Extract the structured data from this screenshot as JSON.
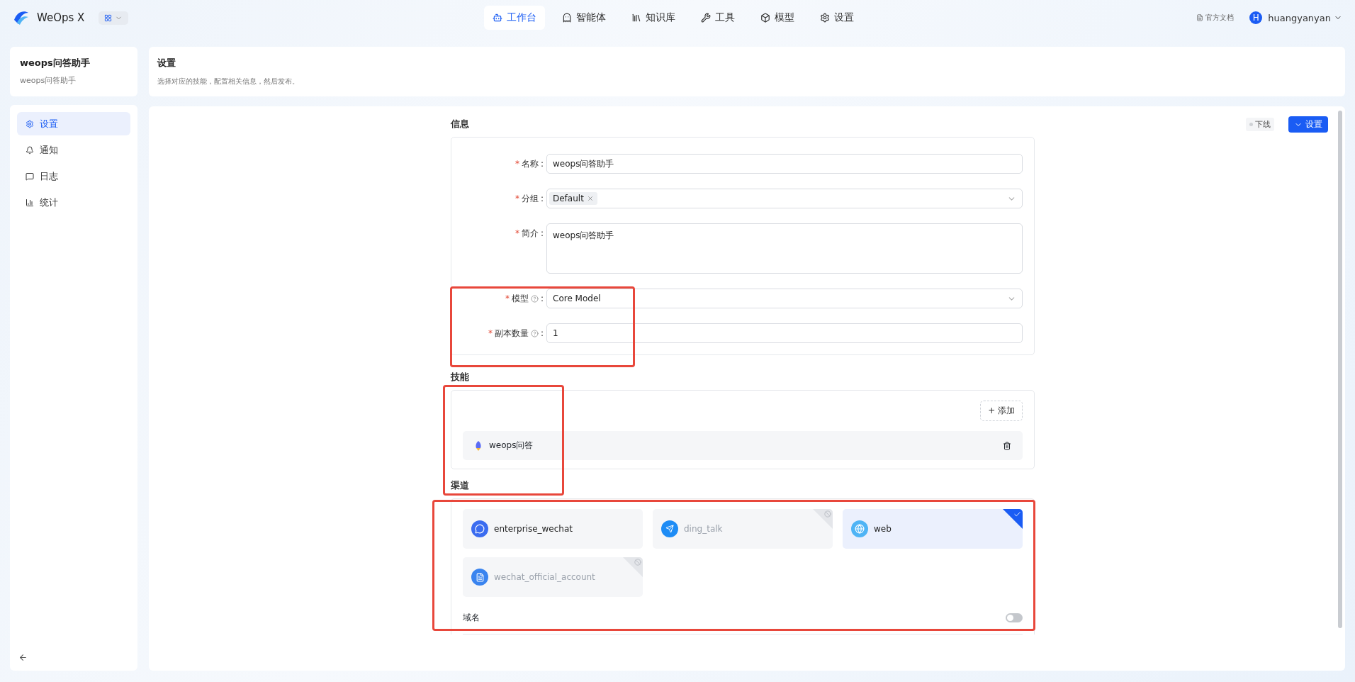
{
  "topbar": {
    "brand": "WeOps X",
    "nav": [
      {
        "label": "工作台",
        "selected": true
      },
      {
        "label": "智能体",
        "selected": false
      },
      {
        "label": "知识库",
        "selected": false
      },
      {
        "label": "工具",
        "selected": false
      },
      {
        "label": "模型",
        "selected": false
      },
      {
        "label": "设置",
        "selected": false
      }
    ],
    "docs": "官方文档",
    "avatar": "H",
    "user": "huangyanyan"
  },
  "agent": {
    "title": "weops问答助手",
    "subtitle": "weops问答助手"
  },
  "sidebar": {
    "items": [
      {
        "label": "设置",
        "selected": true
      },
      {
        "label": "通知",
        "selected": false
      },
      {
        "label": "日志",
        "selected": false
      },
      {
        "label": "统计",
        "selected": false
      }
    ]
  },
  "header": {
    "title": "设置",
    "description": "选择对应的技能，配置相关信息，然后发布。"
  },
  "actions": {
    "status": "下线",
    "button": "设置"
  },
  "info": {
    "title": "信息",
    "fields": [
      {
        "kind": "input",
        "mark": "*",
        "label": "名称",
        "help": false,
        "colon": ":",
        "value": "weops问答助手"
      },
      {
        "kind": "tags",
        "mark": "*",
        "label": "分组",
        "help": false,
        "colon": ":",
        "tags": [
          "Default"
        ]
      },
      {
        "kind": "textarea",
        "mark": "*",
        "label": "简介",
        "help": false,
        "colon": ":",
        "value": "weops问答助手"
      },
      {
        "kind": "select",
        "mark": "*",
        "label": "模型",
        "help": true,
        "colon": ":",
        "value": "Core Model"
      },
      {
        "kind": "input",
        "mark": "*",
        "label": "副本数量",
        "help": true,
        "colon": ":",
        "value": "1"
      }
    ]
  },
  "skills": {
    "title": "技能",
    "add": "+ 添加",
    "items": [
      {
        "name": "weops问答"
      }
    ]
  },
  "channels": {
    "title": "渠道",
    "items": [
      {
        "name": "enterprise_wechat",
        "enabled": true,
        "selected": false
      },
      {
        "name": "ding_talk",
        "enabled": false,
        "selected": false
      },
      {
        "name": "web",
        "enabled": true,
        "selected": true
      },
      {
        "name": "wechat_official_account",
        "enabled": false,
        "selected": false
      }
    ],
    "domain": {
      "label": "域名",
      "on": false
    }
  },
  "annotations": [
    {
      "kind": "highlight",
      "color": "#e8473b"
    },
    {
      "kind": "highlight",
      "color": "#e8473b"
    },
    {
      "kind": "highlight",
      "color": "#e8473b"
    }
  ]
}
